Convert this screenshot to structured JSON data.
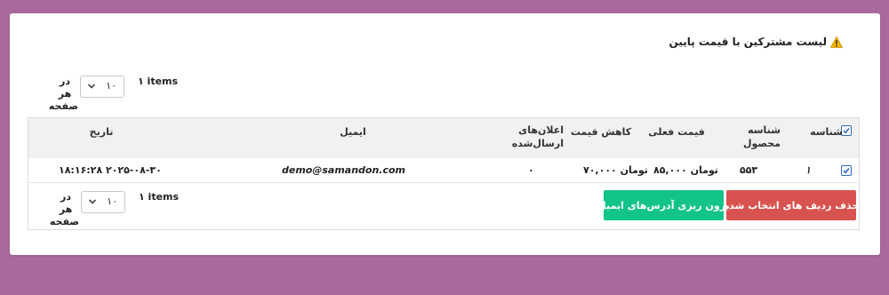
{
  "panel": {
    "title": "لیست مشترکین با قیمت پایین",
    "title_icon": "warning-icon"
  },
  "pager_top": {
    "per_page_label": "در هر صفحه",
    "per_page_value": "۱۰",
    "items_text": "۱ items"
  },
  "pager_bottom": {
    "per_page_label": "در هر صفحه",
    "per_page_value": "۱۰",
    "items_text": "۱ items"
  },
  "table": {
    "headers": {
      "id": "شناسه",
      "product_id": "شناسه محصول",
      "current_price": "قیمت فعلی",
      "price_drop": "کاهش قیمت",
      "notifications_sent": "اعلان‌های ارسال‌شده",
      "email": "ایمیل",
      "date": "تاریخ"
    },
    "rows": [
      {
        "checked": true,
        "id": "۱",
        "product_id": "۵۵۳",
        "current_price": "۸۵,۰۰۰ تومان",
        "price_drop": "۷۰,۰۰۰ تومان",
        "notifications_sent": "۰",
        "email": "demo@samandon.com",
        "date": "۲۰۲۵-۰۸-۳۰ ۱۸:۱۶:۲۸"
      }
    ],
    "select_all_checked": true
  },
  "actions": {
    "delete_label": "حذف ردیف های انتخاب شده",
    "export_label": "برون ریزی آدرس‌های ایمیل"
  },
  "colors": {
    "background": "#a8699d",
    "delete_button": "#d8534f",
    "export_button": "#12c38a",
    "checkbox": "#2f6cc2"
  }
}
